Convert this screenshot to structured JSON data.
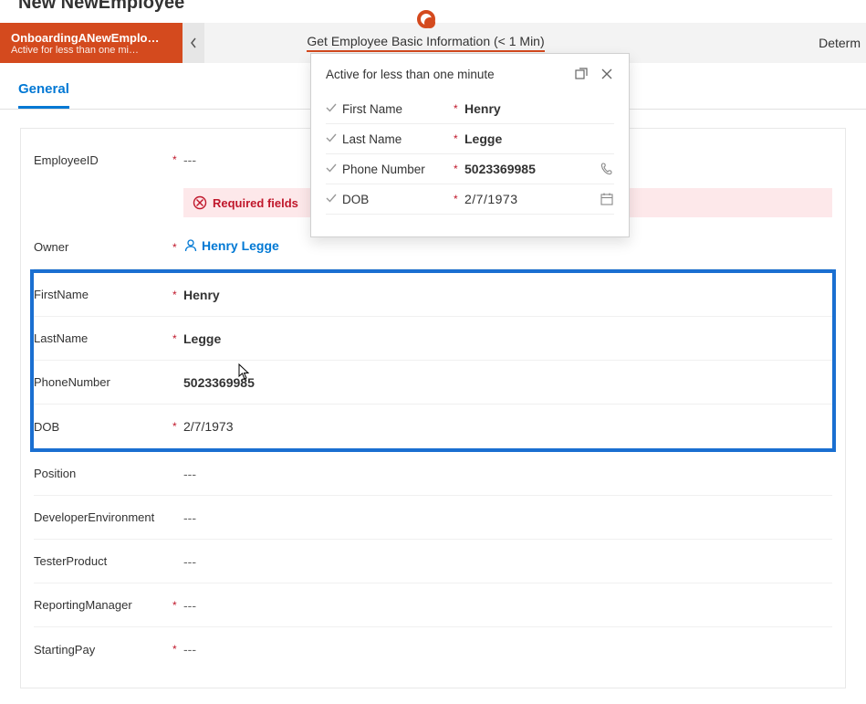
{
  "page": {
    "title": "New NewEmployee"
  },
  "stages": {
    "active": {
      "title": "OnboardingANewEmplo…",
      "sub": "Active for less than one mi…"
    },
    "current": "Get Employee Basic Information  (< 1 Min)",
    "next": "Determ"
  },
  "tabs": {
    "general": "General"
  },
  "form": {
    "empty": "---",
    "employeeId": {
      "label": "EmployeeID",
      "required": true
    },
    "errorBanner": "Required fields",
    "owner": {
      "label": "Owner",
      "required": true,
      "value": "Henry Legge"
    },
    "firstName": {
      "label": "FirstName",
      "required": true,
      "value": "Henry"
    },
    "lastName": {
      "label": "LastName",
      "required": true,
      "value": "Legge"
    },
    "phone": {
      "label": "PhoneNumber",
      "required": false,
      "value": "5023369985"
    },
    "dob": {
      "label": "DOB",
      "required": true,
      "value": "2/7/1973"
    },
    "position": {
      "label": "Position",
      "required": false
    },
    "devEnv": {
      "label": "DeveloperEnvironment",
      "required": false
    },
    "tester": {
      "label": "TesterProduct",
      "required": false
    },
    "mgr": {
      "label": "ReportingManager",
      "required": true
    },
    "pay": {
      "label": "StartingPay",
      "required": true
    }
  },
  "flyout": {
    "header": "Active for less than one minute",
    "firstName": {
      "label": "First Name",
      "value": "Henry"
    },
    "lastName": {
      "label": "Last Name",
      "value": "Legge"
    },
    "phone": {
      "label": "Phone Number",
      "value": "5023369985"
    },
    "dob": {
      "label": "DOB",
      "value": "2/7/1973"
    }
  },
  "colors": {
    "accent": "#d44a1e",
    "link": "#0078d4",
    "error": "#c0172b",
    "highlight": "#1a6fd1"
  }
}
